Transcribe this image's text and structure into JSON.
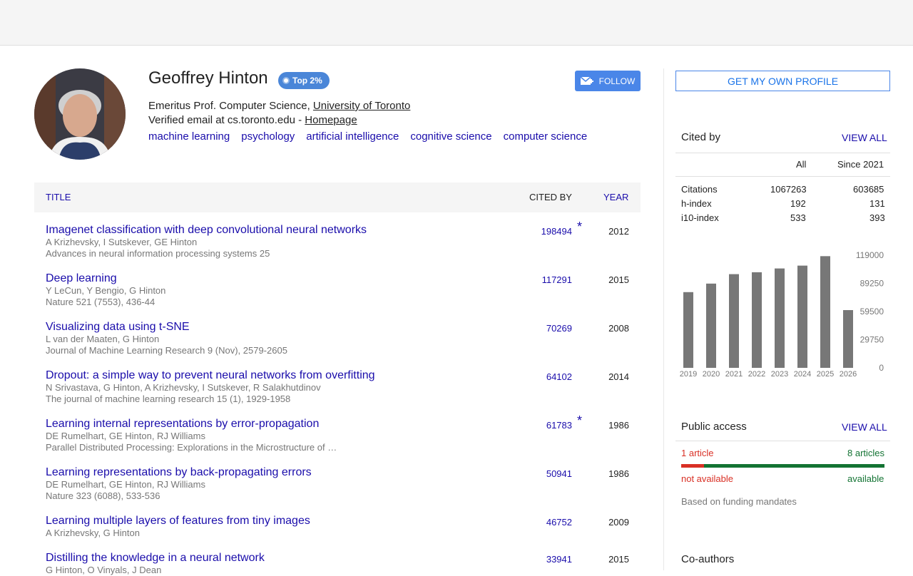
{
  "profile": {
    "name": "Geoffrey Hinton",
    "badge": "Top 2%",
    "affiliation_prefix": "Emeritus Prof. Computer Science, ",
    "affiliation_link": "University of Toronto",
    "email_text": "Verified email at cs.toronto.edu - ",
    "homepage": "Homepage",
    "follow_label": "FOLLOW",
    "interests": [
      "machine learning",
      "psychology",
      "artificial intelligence",
      "cognitive science",
      "computer science"
    ]
  },
  "table": {
    "col_title": "TITLE",
    "col_cited": "CITED BY",
    "col_year": "YEAR",
    "rows": [
      {
        "title": "Imagenet classification with deep convolutional neural networks",
        "authors": "A Krizhevsky, I Sutskever, GE Hinton",
        "venue": "Advances in neural information processing systems 25",
        "cited": "198494",
        "star": "*",
        "year": "2012"
      },
      {
        "title": "Deep learning",
        "authors": "Y LeCun, Y Bengio, G Hinton",
        "venue": "Nature 521 (7553), 436-44",
        "cited": "117291",
        "star": "",
        "year": "2015"
      },
      {
        "title": "Visualizing data using t-SNE",
        "authors": "L van der Maaten, G Hinton",
        "venue": "Journal of Machine Learning Research 9 (Nov), 2579-2605",
        "cited": "70269",
        "star": "",
        "year": "2008"
      },
      {
        "title": "Dropout: a simple way to prevent neural networks from overfitting",
        "authors": "N Srivastava, G Hinton, A Krizhevsky, I Sutskever, R Salakhutdinov",
        "venue": "The journal of machine learning research 15 (1), 1929-1958",
        "cited": "64102",
        "star": "",
        "year": "2014"
      },
      {
        "title": "Learning internal representations by error-propagation",
        "authors": "DE Rumelhart, GE Hinton, RJ Williams",
        "venue": "Parallel Distributed Processing: Explorations in the Microstructure of …",
        "cited": "61783",
        "star": "*",
        "year": "1986"
      },
      {
        "title": "Learning representations by back-propagating errors",
        "authors": "DE Rumelhart, GE Hinton, RJ Williams",
        "venue": "Nature 323 (6088), 533-536",
        "cited": "50941",
        "star": "",
        "year": "1986"
      },
      {
        "title": "Learning multiple layers of features from tiny images",
        "authors": "A Krizhevsky, G Hinton",
        "venue": "",
        "cited": "46752",
        "star": "",
        "year": "2009"
      },
      {
        "title": "Distilling the knowledge in a neural network",
        "authors": "G Hinton, O Vinyals, J Dean",
        "venue": "",
        "cited": "33941",
        "star": "",
        "year": "2015"
      }
    ]
  },
  "sidebar": {
    "get_own": "GET MY OWN PROFILE",
    "cited_by": {
      "title": "Cited by",
      "view_all": "VIEW ALL",
      "col_all": "All",
      "col_since": "Since 2021",
      "stats": [
        {
          "label": "Citations",
          "all": "1067263",
          "since": "603685"
        },
        {
          "label": "h-index",
          "all": "192",
          "since": "131"
        },
        {
          "label": "i10-index",
          "all": "533",
          "since": "393"
        }
      ]
    },
    "public_access": {
      "title": "Public access",
      "view_all": "VIEW ALL",
      "left_count": "1 article",
      "right_count": "8 articles",
      "left_label": "not available",
      "right_label": "available",
      "note": "Based on funding mandates",
      "available_fraction": 0.889,
      "colors": {
        "not_available": "#d93025",
        "available": "#137333"
      }
    },
    "coauthors_title": "Co-authors"
  },
  "chart_data": {
    "type": "bar",
    "categories": [
      "2019",
      "2020",
      "2021",
      "2022",
      "2023",
      "2024",
      "2025",
      "2026"
    ],
    "values": [
      80000,
      89000,
      99000,
      101000,
      105000,
      108000,
      118000,
      61000
    ],
    "ylim": [
      0,
      119000
    ],
    "y_ticks": [
      "119000",
      "89250",
      "59500",
      "29750",
      "0"
    ],
    "bar_color": "#777777"
  }
}
